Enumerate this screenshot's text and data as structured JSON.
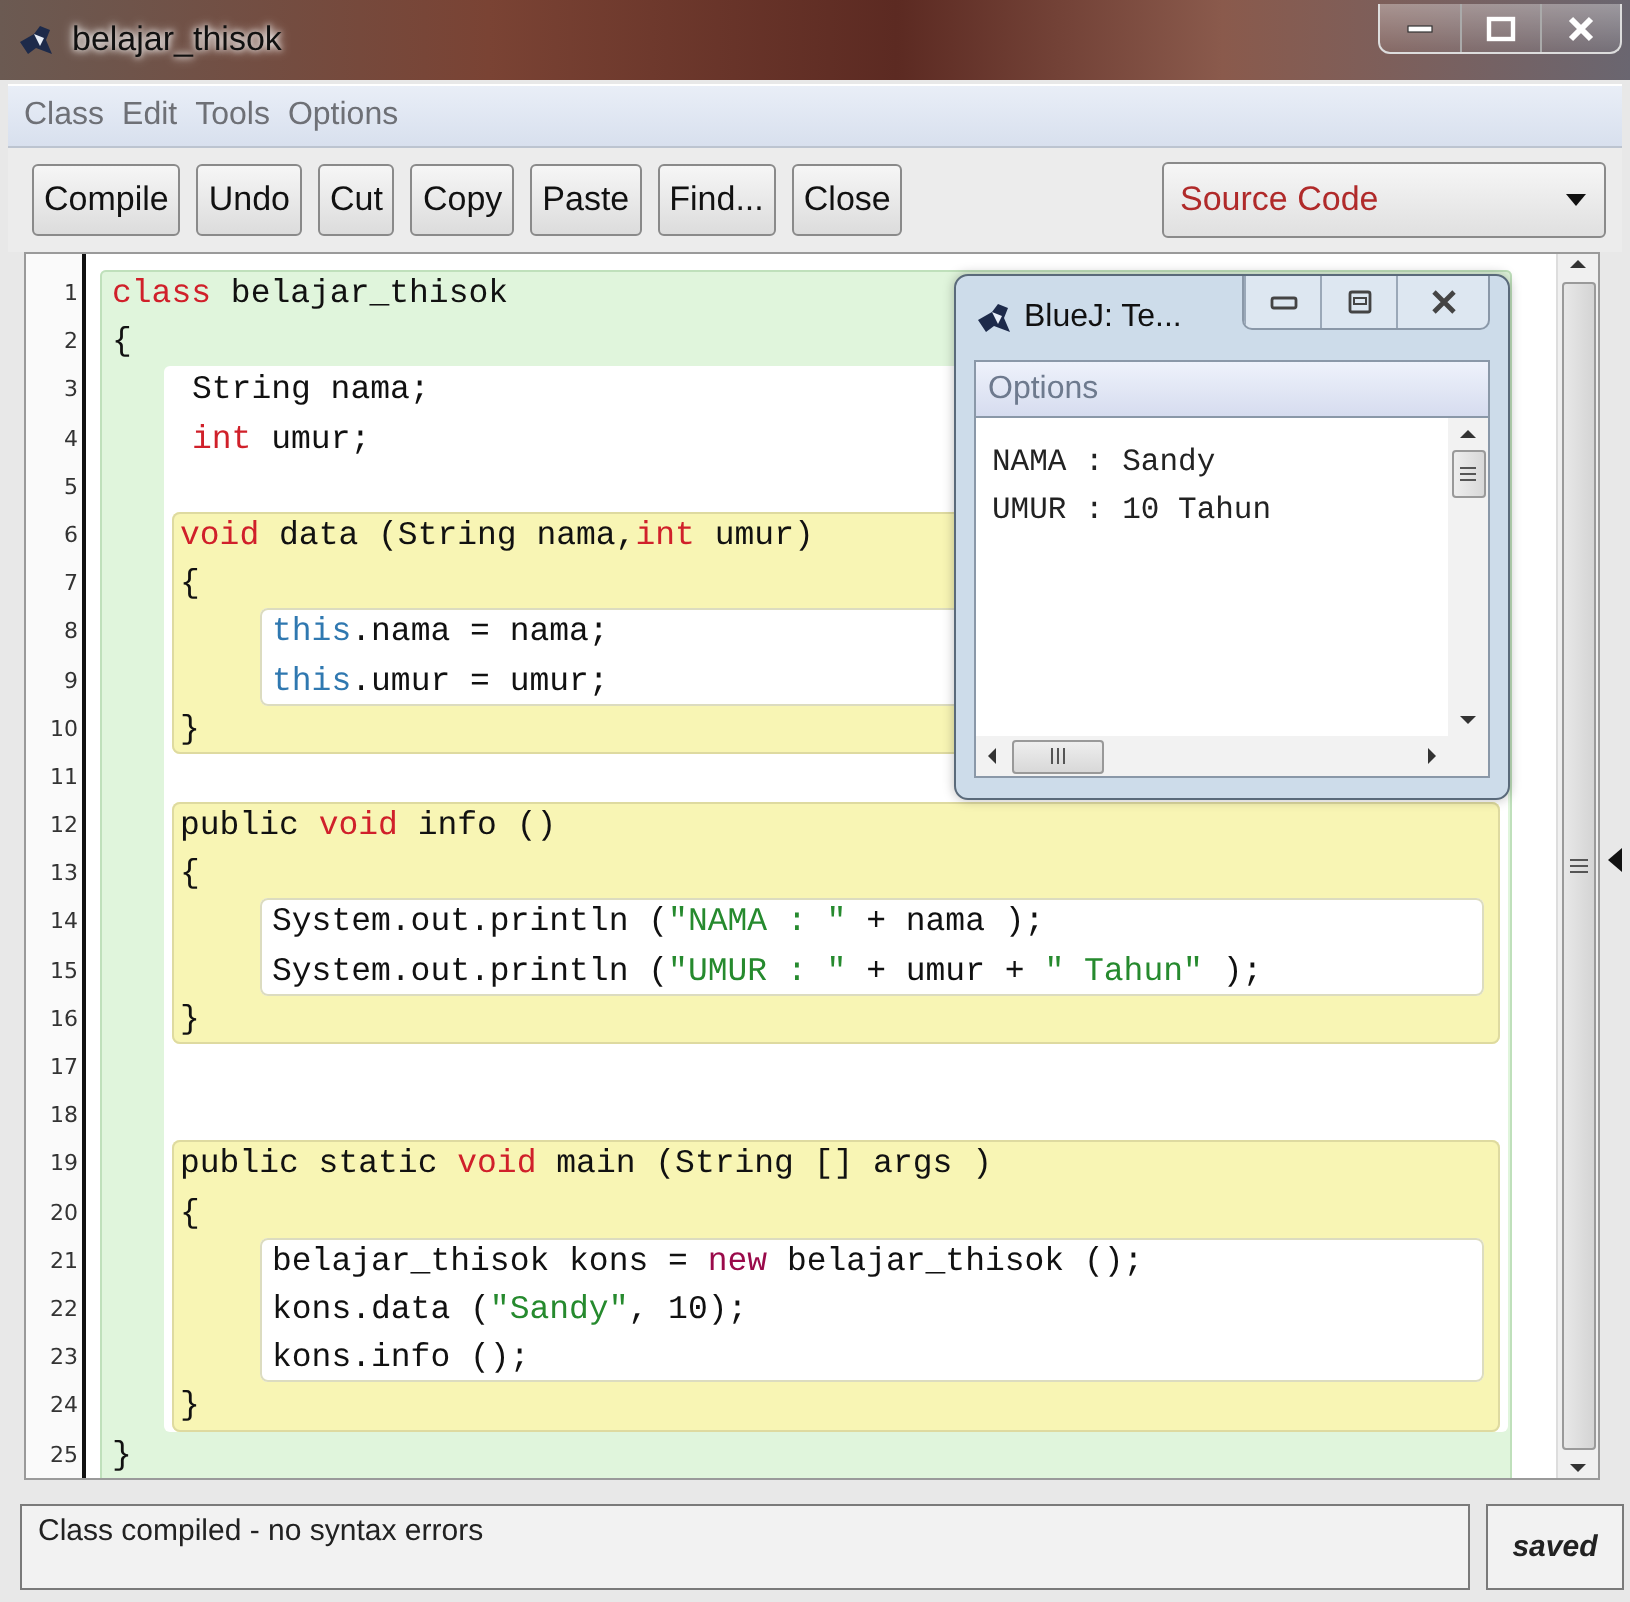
{
  "window": {
    "title": "belajar_thisok"
  },
  "menu": [
    "Class",
    "Edit",
    "Tools",
    "Options"
  ],
  "toolbar": {
    "buttons": [
      "Compile",
      "Undo",
      "Cut",
      "Copy",
      "Paste",
      "Find...",
      "Close"
    ],
    "view": "Source Code"
  },
  "editor": {
    "line_numbers": [
      "1",
      "2",
      "3",
      "4",
      "5",
      "6",
      "7",
      "8",
      "9",
      "10",
      "11",
      "12",
      "13",
      "14",
      "15",
      "16",
      "17",
      "18",
      "19",
      "20",
      "21",
      "22",
      "23",
      "24",
      "25"
    ],
    "code": {
      "kind": "class",
      "items": [
        {
          "kind": "line",
          "tokens": [
            {
              "text": "class",
              "kind": "keyword"
            },
            {
              "text": " belajar_thisok",
              "kind": "plain"
            }
          ]
        },
        {
          "kind": "line",
          "tokens": [
            {
              "text": "{",
              "kind": "plain"
            }
          ]
        },
        {
          "kind": "fields",
          "items": [
            {
              "kind": "line",
              "tokens": [
                {
                  "text": "String nama;",
                  "kind": "plain"
                }
              ]
            },
            {
              "kind": "line",
              "tokens": [
                {
                  "text": "int",
                  "kind": "keyword"
                },
                {
                  "text": " umur;",
                  "kind": "plain"
                }
              ]
            },
            {
              "kind": "blank"
            },
            {
              "kind": "method",
              "items": [
                {
                  "kind": "line",
                  "tokens": [
                    {
                      "text": "void",
                      "kind": "keyword"
                    },
                    {
                      "text": " data (String nama,",
                      "kind": "plain"
                    },
                    {
                      "text": "int",
                      "kind": "keyword"
                    },
                    {
                      "text": " umur)",
                      "kind": "plain"
                    }
                  ]
                },
                {
                  "kind": "line",
                  "tokens": [
                    {
                      "text": "{",
                      "kind": "plain"
                    }
                  ]
                },
                {
                  "kind": "body",
                  "items": [
                    {
                      "kind": "line",
                      "tokens": [
                        {
                          "text": "this",
                          "kind": "this"
                        },
                        {
                          "text": ".nama = nama;",
                          "kind": "plain"
                        }
                      ]
                    },
                    {
                      "kind": "line",
                      "tokens": [
                        {
                          "text": "this",
                          "kind": "this"
                        },
                        {
                          "text": ".umur = umur;",
                          "kind": "plain"
                        }
                      ]
                    }
                  ]
                },
                {
                  "kind": "line",
                  "tokens": [
                    {
                      "text": "}",
                      "kind": "plain"
                    }
                  ]
                }
              ]
            },
            {
              "kind": "blank"
            },
            {
              "kind": "method",
              "items": [
                {
                  "kind": "line",
                  "tokens": [
                    {
                      "text": "public ",
                      "kind": "plain"
                    },
                    {
                      "text": "void",
                      "kind": "keyword"
                    },
                    {
                      "text": " info ()",
                      "kind": "plain"
                    }
                  ]
                },
                {
                  "kind": "line",
                  "tokens": [
                    {
                      "text": "{",
                      "kind": "plain"
                    }
                  ]
                },
                {
                  "kind": "body",
                  "items": [
                    {
                      "kind": "line",
                      "tokens": [
                        {
                          "text": "System.out.println (",
                          "kind": "plain"
                        },
                        {
                          "text": "\"NAMA : \"",
                          "kind": "string"
                        },
                        {
                          "text": " + nama );",
                          "kind": "plain"
                        }
                      ]
                    },
                    {
                      "kind": "line",
                      "tokens": [
                        {
                          "text": "System.out.println (",
                          "kind": "plain"
                        },
                        {
                          "text": "\"UMUR : \"",
                          "kind": "string"
                        },
                        {
                          "text": " + umur + ",
                          "kind": "plain"
                        },
                        {
                          "text": "\" Tahun\"",
                          "kind": "string"
                        },
                        {
                          "text": " );",
                          "kind": "plain"
                        }
                      ]
                    }
                  ]
                },
                {
                  "kind": "line",
                  "tokens": [
                    {
                      "text": "}",
                      "kind": "plain"
                    }
                  ]
                }
              ]
            },
            {
              "kind": "blank"
            },
            {
              "kind": "blank"
            },
            {
              "kind": "method",
              "items": [
                {
                  "kind": "line",
                  "tokens": [
                    {
                      "text": "public static ",
                      "kind": "plain"
                    },
                    {
                      "text": "void",
                      "kind": "keyword"
                    },
                    {
                      "text": " main (String [] args )",
                      "kind": "plain"
                    }
                  ]
                },
                {
                  "kind": "line",
                  "tokens": [
                    {
                      "text": "{",
                      "kind": "plain"
                    }
                  ]
                },
                {
                  "kind": "body",
                  "items": [
                    {
                      "kind": "line",
                      "tokens": [
                        {
                          "text": "belajar_thisok kons = ",
                          "kind": "plain"
                        },
                        {
                          "text": "new",
                          "kind": "new"
                        },
                        {
                          "text": " belajar_thisok ();",
                          "kind": "plain"
                        }
                      ]
                    },
                    {
                      "kind": "line",
                      "tokens": [
                        {
                          "text": "kons.data (",
                          "kind": "plain"
                        },
                        {
                          "text": "\"Sandy\"",
                          "kind": "string"
                        },
                        {
                          "text": ", 10);",
                          "kind": "plain"
                        }
                      ]
                    },
                    {
                      "kind": "line",
                      "tokens": [
                        {
                          "text": "kons.info ();",
                          "kind": "plain"
                        }
                      ]
                    }
                  ]
                },
                {
                  "kind": "line",
                  "tokens": [
                    {
                      "text": "}",
                      "kind": "plain"
                    }
                  ]
                }
              ]
            }
          ]
        },
        {
          "kind": "line",
          "tokens": [
            {
              "text": "}",
              "kind": "plain"
            }
          ]
        }
      ]
    }
  },
  "terminal": {
    "title": "BlueJ: Te...",
    "menu": [
      "Options"
    ],
    "output": [
      "NAMA : Sandy",
      "UMUR : 10 Tahun"
    ]
  },
  "status_bar": {
    "message": "Class compiled - no syntax errors",
    "save_state": "saved"
  }
}
